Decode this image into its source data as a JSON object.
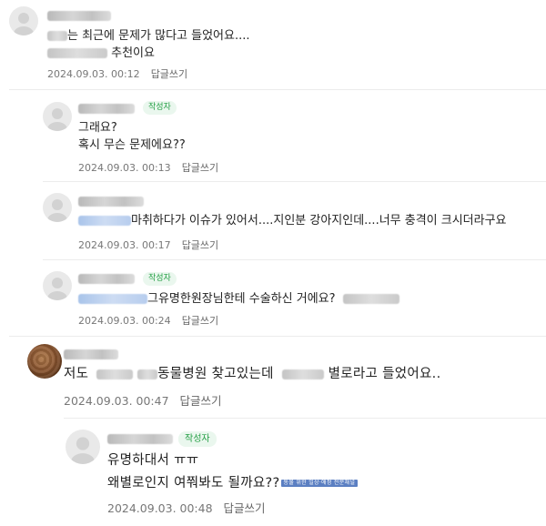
{
  "author_badge": "작성자",
  "reply_label": "답글쓰기",
  "comments": [
    {
      "lines": [
        "는 최근에 문제가 많다고 들었어요....",
        "추천이요"
      ],
      "timestamp": "2024.09.03. 00:12"
    },
    {
      "lines": [
        "그래요?",
        "혹시 무슨 문제에요??"
      ],
      "timestamp": "2024.09.03. 00:13"
    },
    {
      "lines": [
        "마취하다가 이슈가 있어서....지인분 강아지인데....너무 충격이 크시더라구요"
      ],
      "timestamp": "2024.09.03. 00:17"
    },
    {
      "lines": [
        "그유명한원장님한테 수술하신 거에요?"
      ],
      "timestamp": "2024.09.03. 00:24"
    },
    {
      "lines": [
        "저도",
        "동물병원 찾고있는데",
        "별로라고 들었어요.."
      ],
      "timestamp": "2024.09.03. 00:47"
    },
    {
      "lines": [
        "유명하대서 ㅠㅠ",
        "왜별로인지 여쭤봐도 될까요??"
      ],
      "watermark": "동물 위한 일상·애정 전문채널",
      "timestamp": "2024.09.03. 00:48"
    }
  ]
}
